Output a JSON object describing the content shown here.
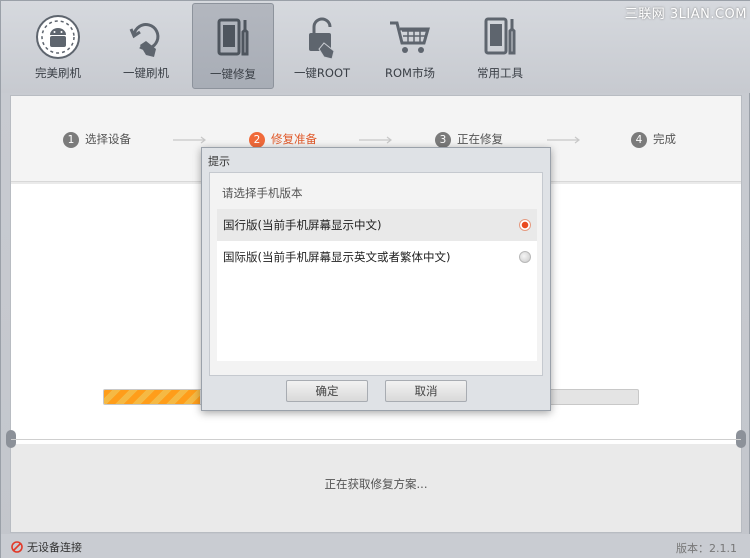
{
  "toolbar": {
    "items": [
      {
        "label": "完美刷机",
        "icon": "android-icon"
      },
      {
        "label": "一键刷机",
        "icon": "refresh-hand-icon"
      },
      {
        "label": "一键修复",
        "icon": "phone-wrench-icon"
      },
      {
        "label": "一键ROOT",
        "icon": "unlock-icon"
      },
      {
        "label": "ROM市场",
        "icon": "cart-icon"
      },
      {
        "label": "常用工具",
        "icon": "tools-icon"
      }
    ],
    "active_index": 2,
    "watermark": "三联网 3LIAN.COM"
  },
  "steps": [
    {
      "num": "1",
      "label": "选择设备"
    },
    {
      "num": "2",
      "label": "修复准备"
    },
    {
      "num": "3",
      "label": "正在修复"
    },
    {
      "num": "4",
      "label": "完成"
    }
  ],
  "active_step": 1,
  "progress": {
    "fraction": 0.18
  },
  "status_message": "正在获取修复方案...",
  "dialog": {
    "title": "提示",
    "prompt": "请选择手机版本",
    "options": [
      {
        "label": "国行版(当前手机屏幕显示中文)",
        "selected": true
      },
      {
        "label": "国际版(当前手机屏幕显示英文或者繁体中文)",
        "selected": false
      }
    ],
    "ok_label": "确定",
    "cancel_label": "取消"
  },
  "bottom": {
    "connection": "无设备连接",
    "version": "版本：2.1.1"
  },
  "colors": {
    "accent": "#f06a3a",
    "progress": "#ff9d1a"
  }
}
